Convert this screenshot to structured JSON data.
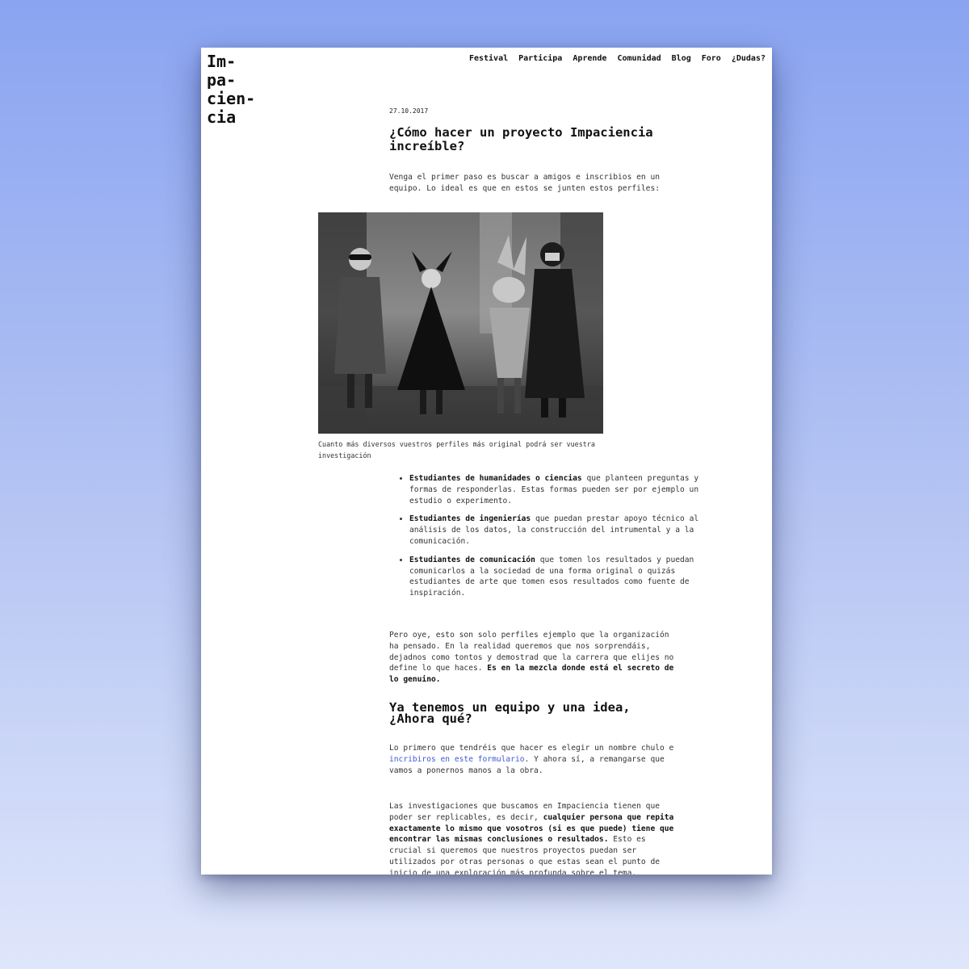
{
  "site": {
    "logo_lines": [
      "Im-",
      "pa-",
      "cien-",
      "cia"
    ]
  },
  "nav": {
    "items": [
      "Festival",
      "Participa",
      "Aprende",
      "Comunidad",
      "Blog",
      "Foro",
      "¿Dudas?"
    ]
  },
  "article": {
    "date": "27.10.2017",
    "title": "¿Cómo hacer un proyecto Impaciencia increíble?",
    "intro": "Venga el primer paso es buscar a amigos e inscribios en un equipo. Lo ideal es que en estos se junten estos perfiles:",
    "image_caption": "Cuanto más diversos vuestros perfiles más original podrá ser vuestra investigación",
    "profiles": [
      {
        "bold": "Estudiantes de humanidades o ciencias",
        "text": " que planteen preguntas y formas de responderlas. Estas formas pueden ser por ejemplo un estudio o experimento."
      },
      {
        "bold": "Estudiantes de ingenierías",
        "text": " que puedan prestar apoyo técnico al análisis de los datos, la construcción del intrumental y a la comunicación."
      },
      {
        "bold": "Estudiantes de comunicación",
        "text": " que tomen los resultados y puedan comunicarlos a la sociedad de una forma original o quizás estudiantes de arte que tomen esos resultados como fuente de inspiración."
      }
    ],
    "closing_text": "Pero oye, esto son solo perfiles ejemplo que la organización ha pensado. En la realidad queremos que nos sorprendáis, dejadnos como tontos y demostrad que la carrera que elijes no define lo que haces. ",
    "closing_bold": "Es en la mezcla donde está el secreto de lo genuino.",
    "section2_title": "Ya tenemos un equipo y una idea, ¿Ahora qué?",
    "section2_text_before": "Lo primero que tendréis que hacer es elegir un nombre chulo e ",
    "section2_link": "incribiros en este formulario",
    "section2_text_after": ". Y ahora sí, a remangarse que vamos a ponernos manos a la obra.",
    "section3_text_before": "Las investigaciones que buscamos en Impaciencia tienen que poder ser replicables, es decir, ",
    "section3_bold": "cualquier persona que repita exactamente lo mismo que vosotros (si es que puede) tiene que encontrar las mismas conclusiones o resultados.",
    "section3_text_after": " Esto es crucial si queremos que nuestros proyectos puedan ser utilizados por otras personas o que estas sean el punto de inicio de una exploración más profunda sobre el tema."
  },
  "colors": {
    "background_top": "#8aa4f1",
    "background_bottom": "#dfe6fb",
    "link": "#3f58d6",
    "text": "#333333"
  }
}
